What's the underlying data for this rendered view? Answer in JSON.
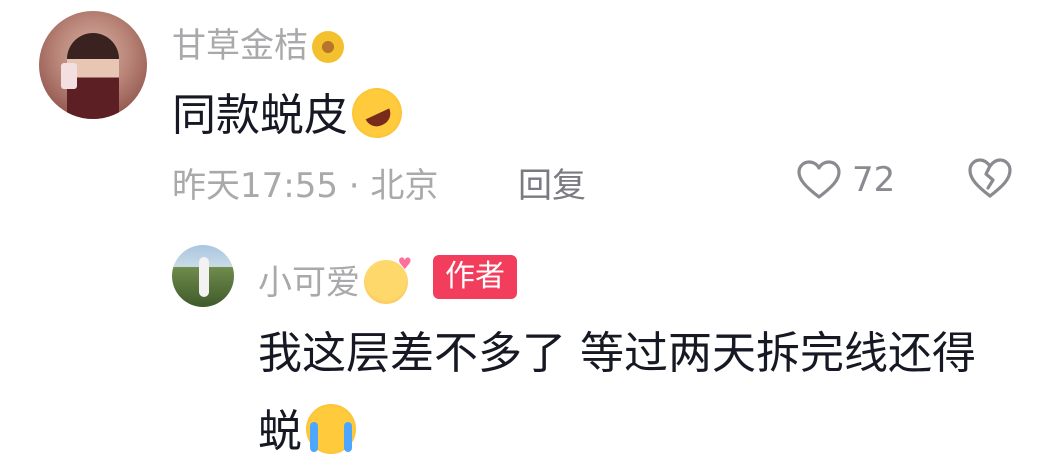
{
  "comment": {
    "username": "甘草金桔",
    "username_emoji": "sunflower-icon",
    "text": "同款蜕皮",
    "text_emoji": "rolling-laughing-emoji",
    "time": "昨天17:55",
    "separator": "·",
    "location": "北京",
    "reply_label": "回复",
    "like_count": "72"
  },
  "reply": {
    "username": "小可爱",
    "username_emoji": "smiling-hearts-emoji",
    "badge": "作者",
    "text_line1": "我这层差不多了 等过两天拆完线还得",
    "text_line2": "蜕",
    "text_emoji": "crying-emoji"
  },
  "colors": {
    "muted_text": "#a9a9ab",
    "main_text": "#161823",
    "badge_bg": "#f23d5c"
  }
}
